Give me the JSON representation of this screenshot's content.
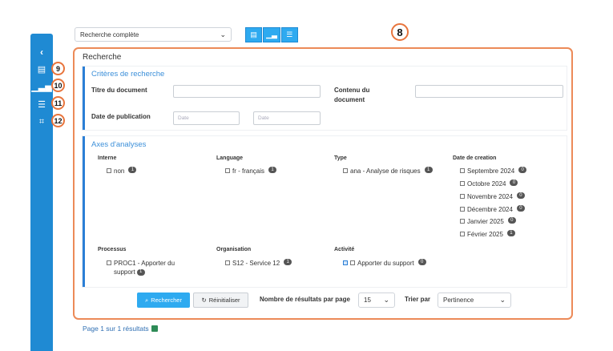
{
  "topbar": {
    "search_select_value": "Recherche complète",
    "view_icons": [
      "table-icon",
      "bar-chart-icon",
      "list-icon"
    ],
    "callout": "8"
  },
  "sidebar": {
    "collapse_icon": "chevron-left-icon",
    "items": [
      {
        "icon": "table-icon",
        "callout": "9"
      },
      {
        "icon": "bar-chart-icon",
        "callout": "10"
      },
      {
        "icon": "list-icon",
        "callout": "11"
      },
      {
        "icon": "hierarchy-icon",
        "callout": "12"
      }
    ]
  },
  "panel": {
    "title": "Recherche",
    "criteria": {
      "title": "Critères de recherche",
      "doc_title_label": "Titre du document",
      "doc_content_label": "Contenu du document",
      "pub_date_label": "Date de publication",
      "date_from_placeholder": "Date",
      "date_to_placeholder": "Date"
    },
    "axes": {
      "title": "Axes d'analyses",
      "groups": {
        "interne": {
          "label": "Interne",
          "items": [
            {
              "text": "non",
              "count": "1"
            }
          ]
        },
        "language": {
          "label": "Language",
          "items": [
            {
              "text": "fr - français",
              "count": "1"
            }
          ]
        },
        "type": {
          "label": "Type",
          "items": [
            {
              "text": "ana - Analyse de risques",
              "count": "1"
            }
          ]
        },
        "date": {
          "label": "Date de creation",
          "items": [
            {
              "text": "Septembre 2024",
              "count": "0"
            },
            {
              "text": "Octobre 2024",
              "count": "0"
            },
            {
              "text": "Novembre 2024",
              "count": "0"
            },
            {
              "text": "Décembre 2024",
              "count": "0"
            },
            {
              "text": "Janvier 2025",
              "count": "0"
            },
            {
              "text": "Février 2025",
              "count": "1"
            }
          ]
        },
        "processus": {
          "label": "Processus",
          "items": [
            {
              "text": "PROC1 - Apporter du support",
              "count": "1"
            }
          ]
        },
        "organisation": {
          "label": "Organisation",
          "items": [
            {
              "text": "S12 - Service 12",
              "count": "1"
            }
          ]
        },
        "activite": {
          "label": "Activité",
          "items": [
            {
              "text": "Apporter du support",
              "count": "0"
            }
          ]
        }
      }
    },
    "toolbar": {
      "search_label": "Rechercher",
      "reset_label": "Réinitialiser",
      "per_page_label": "Nombre de résultats par page",
      "per_page_value": "15",
      "sort_label": "Trier par",
      "sort_value": "Pertinence"
    }
  },
  "footer": {
    "pagination": "Page 1 sur 1 résultats"
  },
  "colors": {
    "accent": "#2eaaf0",
    "rail": "#1f8ad3",
    "callout": "#ec8a58",
    "section_bar": "#2b7fd6"
  }
}
